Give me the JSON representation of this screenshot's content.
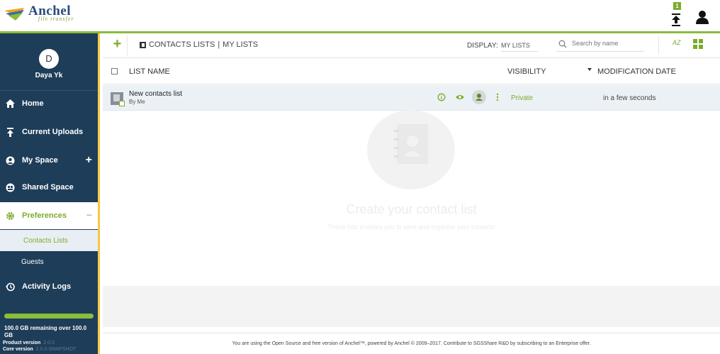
{
  "brand": {
    "name": "Anchel",
    "tagline": "file transfer",
    "accent": "#7cab2c",
    "sidebar_bg": "#1e3d59"
  },
  "topbar": {
    "upload_count": "1",
    "upload_icon": "upload-queue-icon",
    "user_icon": "user-icon"
  },
  "sidebar": {
    "profile": {
      "initial": "D",
      "name": "Daya Yk"
    },
    "items": [
      {
        "label": "Home",
        "icon": "home-icon"
      },
      {
        "label": "Current Uploads",
        "icon": "upload-icon"
      },
      {
        "label": "My Space",
        "icon": "user-circle-icon",
        "action": "+"
      },
      {
        "label": "Shared Space",
        "icon": "group-icon"
      },
      {
        "label": "Preferences",
        "icon": "gear-icon",
        "action": "−"
      },
      {
        "label": "Activity Logs",
        "icon": "history-icon"
      }
    ],
    "sub_items": [
      {
        "label": "Contacts Lists"
      },
      {
        "label": "Guests"
      }
    ],
    "quota": {
      "text": "100.0 GB remaining over 100.0 GB",
      "fraction_remaining": 1.0
    },
    "product_version_label": "Product version",
    "product_version": "2.0.0",
    "core_version_label": "Core version",
    "core_version": "2.0.0-SNAPSHOT"
  },
  "toolbar": {
    "add_label": "+",
    "crumb_root": "CONTACTS LISTS",
    "crumb_sep": "|",
    "crumb_current": "MY LISTS",
    "display_label": "DISPLAY:",
    "display_value": "MY LISTS",
    "search_placeholder": "Search by name",
    "sort_label": "AZ"
  },
  "table": {
    "headers": {
      "name": "LIST NAME",
      "visibility": "VISIBILITY",
      "modification": "MODIFICATION DATE"
    },
    "rows": [
      {
        "title": "New contacts list",
        "owner": "By Me",
        "visibility": "Private",
        "modified": "in a few seconds"
      }
    ]
  },
  "empty_state": {
    "title": "Create your contact list",
    "subtitle": "These lists enables you to save and organise your contacts"
  },
  "footer": {
    "text": "You are using the Open Source and free version of Anchel™, powered by Anchel © 2009–2017. Contribute to SGSShare R&D by subscribing to an Enterprise offer."
  }
}
